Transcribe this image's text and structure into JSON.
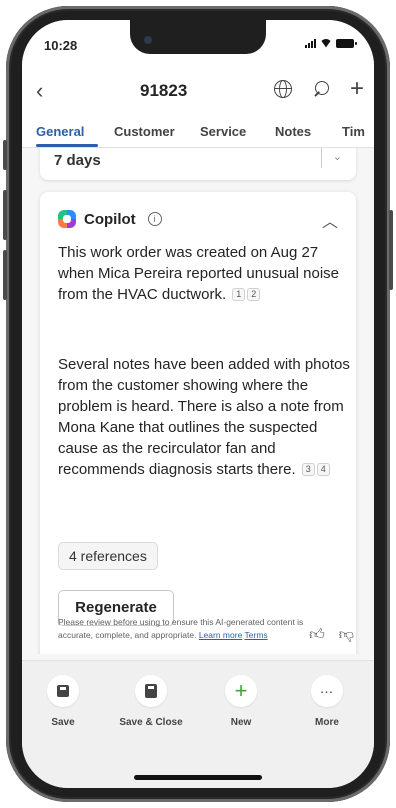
{
  "status": {
    "time": "10:28"
  },
  "header": {
    "title": "91823"
  },
  "tabs": [
    "General",
    "Customer",
    "Service",
    "Notes",
    "Tim"
  ],
  "previous_field": {
    "value": "7 days"
  },
  "copilot": {
    "name": "Copilot",
    "paragraph1": "This work order was created on Aug 27 when Mica Pereira reported unusual noise from the HVAC ductwork.",
    "paragraph1_refs": [
      "1",
      "2"
    ],
    "paragraph2": "Several notes have been added with photos from the customer showing where the problem is heard. There is also a note from Mona Kane that outlines the suspected cause as the recirculator fan and recommends diagnosis starts there.",
    "paragraph2_refs": [
      "3",
      "4"
    ],
    "references_label": "4 references",
    "regenerate_label": "Regenerate"
  },
  "disclaimer": {
    "text": "Please review before using to ensure this AI-generated content is accurate, complete, and appropriate.",
    "learn_more": "Learn more",
    "terms": "Terms"
  },
  "bottom_bar": [
    {
      "label": "Save",
      "icon": "save-icon"
    },
    {
      "label": "Save & Close",
      "icon": "save-close-icon"
    },
    {
      "label": "New",
      "icon": "plus-icon"
    },
    {
      "label": "More",
      "icon": "more-icon"
    }
  ],
  "colors": {
    "accent": "#2b5fa8",
    "new_green": "#3aa63a"
  }
}
